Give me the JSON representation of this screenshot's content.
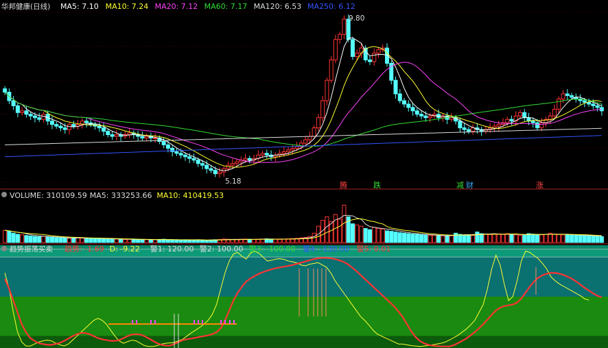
{
  "price_panel": {
    "title": "华邦健康(日线)",
    "ma": [
      {
        "label": "MA5: 7.10",
        "color": "#ffffff"
      },
      {
        "label": "MA10: 7.24",
        "color": "#ffff33"
      },
      {
        "label": "MA20: 7.12",
        "color": "#ff44ff"
      },
      {
        "label": "MA60: 7.17",
        "color": "#33dd33"
      },
      {
        "label": "MA120: 6.53",
        "color": "#dddddd"
      },
      {
        "label": "MA250: 6.12",
        "color": "#3355ff"
      }
    ],
    "high_label": "9.80",
    "low_label": "5.18",
    "event_tags": [
      {
        "text": "腾",
        "color": "#ff4444"
      },
      {
        "text": "跌",
        "color": "#33dd33"
      },
      {
        "text": "减",
        "color": "#33dd33"
      },
      {
        "text": "财",
        "color": "#33aaff"
      },
      {
        "text": "涨",
        "color": "#ff4444"
      }
    ]
  },
  "volume_panel": {
    "labels": [
      {
        "label": "VOLUME: 310109.59",
        "color": "#dddddd"
      },
      {
        "label": "MA5: 333253.66",
        "color": "#dddddd"
      },
      {
        "label": "MA10: 410419.53",
        "color": "#ffff33"
      }
    ]
  },
  "indicator_panel": {
    "title": "趋势振荡买卖",
    "labels": [
      {
        "label": "趋势: -1.69",
        "color": "#ff3333"
      },
      {
        "label": "D: -9.22",
        "color": "#ffff33"
      },
      {
        "label": "警1: 120.00",
        "color": "#dddddd"
      },
      {
        "label": "警2: 100.00",
        "color": "#dddddd"
      },
      {
        "label": "警3: -100.00",
        "color": "#33dd33"
      },
      {
        "label": "警4: -130.00",
        "color": "#3355ff"
      },
      {
        "label": "警5: 0.01",
        "color": "#ff3333"
      }
    ]
  },
  "chart_data": [
    {
      "type": "candlestick",
      "title": "华邦健康(日线)",
      "x": [
        1,
        2,
        3,
        4,
        5,
        6,
        7,
        8,
        9,
        10,
        11,
        12,
        13,
        14,
        15,
        16,
        17,
        18,
        19,
        20,
        21,
        22,
        23,
        24,
        25,
        26,
        27,
        28,
        29,
        30,
        31,
        32,
        33,
        34,
        35,
        36,
        37,
        38,
        39,
        40,
        41,
        42,
        43,
        44,
        45,
        46,
        47,
        48,
        49,
        50,
        51,
        52,
        53,
        54,
        55,
        56,
        57,
        58,
        59,
        60,
        61,
        62,
        63,
        64,
        65,
        66,
        67,
        68,
        69,
        70,
        71,
        72,
        73,
        74,
        75,
        76,
        77,
        78,
        79,
        80,
        81,
        82,
        83,
        84,
        85,
        86,
        87,
        88,
        89,
        90,
        91,
        92,
        93,
        94,
        95,
        96,
        97,
        98,
        99,
        100,
        101,
        102,
        103,
        104,
        105,
        106,
        107,
        108,
        109,
        110,
        111,
        112,
        113,
        114,
        115,
        116,
        117,
        118,
        119,
        120,
        121,
        122,
        123,
        124,
        125,
        126,
        127,
        128,
        129,
        130,
        131,
        132,
        133,
        134,
        135,
        136,
        137,
        138,
        139,
        140
      ],
      "close": [
        7.65,
        7.4,
        7.25,
        7.05,
        7.1,
        7.0,
        6.95,
        6.9,
        6.85,
        7.0,
        6.8,
        6.7,
        6.65,
        6.6,
        6.55,
        6.7,
        6.65,
        6.7,
        6.8,
        6.75,
        6.7,
        6.65,
        6.6,
        6.5,
        6.4,
        6.35,
        6.4,
        6.35,
        6.4,
        6.45,
        6.4,
        6.35,
        6.3,
        6.35,
        6.3,
        6.3,
        6.2,
        6.1,
        6.0,
        5.9,
        5.85,
        5.8,
        5.75,
        5.7,
        5.65,
        5.55,
        5.5,
        5.4,
        5.35,
        5.25,
        5.3,
        5.4,
        5.5,
        5.55,
        5.6,
        5.65,
        5.7,
        5.65,
        5.7,
        5.8,
        5.85,
        5.8,
        5.75,
        5.8,
        5.85,
        5.9,
        5.95,
        6.0,
        6.05,
        6.15,
        6.25,
        6.35,
        6.6,
        6.9,
        7.4,
        8.0,
        8.6,
        9.2,
        9.35,
        9.8,
        9.2,
        8.7,
        8.8,
        8.95,
        8.6,
        8.55,
        8.8,
        8.9,
        8.95,
        8.5,
        8.0,
        7.6,
        7.4,
        7.3,
        7.2,
        7.1,
        7.0,
        6.95,
        6.9,
        6.95,
        7.0,
        6.9,
        6.95,
        6.85,
        6.9,
        6.8,
        6.6,
        6.55,
        6.5,
        6.6,
        6.55,
        6.5,
        6.55,
        6.6,
        6.65,
        6.7,
        6.75,
        6.85,
        6.8,
        6.95,
        7.05,
        6.9,
        6.8,
        6.75,
        6.6,
        6.75,
        6.85,
        6.95,
        7.15,
        7.45,
        7.6,
        7.55,
        7.5,
        7.45,
        7.4,
        7.35,
        7.3,
        7.25,
        7.2,
        7.1
      ]
    },
    {
      "type": "bar",
      "title": "VOLUME",
      "values": [
        52,
        48,
        40,
        35,
        33,
        30,
        28,
        26,
        25,
        27,
        24,
        22,
        21,
        20,
        19,
        18,
        20,
        21,
        19,
        18,
        17,
        18,
        17,
        16,
        15,
        14,
        15,
        14,
        13,
        14,
        13,
        12,
        13,
        12,
        11,
        12,
        13,
        14,
        12,
        11,
        10,
        11,
        12,
        10,
        11,
        12,
        10,
        9,
        11,
        12,
        13,
        15,
        14,
        13,
        12,
        14,
        15,
        14,
        13,
        14,
        15,
        16,
        15,
        14,
        13,
        15,
        16,
        17,
        18,
        20,
        22,
        26,
        40,
        70,
        95,
        110,
        90,
        120,
        100,
        160,
        110,
        80,
        75,
        70,
        60,
        55,
        65,
        60,
        58,
        50,
        48,
        45,
        42,
        40,
        38,
        36,
        35,
        33,
        32,
        30,
        31,
        30,
        28,
        30,
        29,
        40,
        35,
        33,
        32,
        30,
        45,
        38,
        36,
        34,
        35,
        37,
        34,
        38,
        36,
        33,
        30,
        32,
        38,
        36,
        34,
        33,
        35,
        40,
        36,
        34,
        33,
        34,
        32,
        31,
        30,
        29,
        28,
        27,
        26,
        25
      ],
      "series": [
        {
          "name": "MA5",
          "values": []
        },
        {
          "name": "MA10",
          "values": []
        }
      ]
    },
    {
      "type": "line",
      "title": "趋势振荡买卖",
      "ylim": [
        -130,
        130
      ],
      "series": [
        {
          "name": "趋势",
          "color": "#ff3333",
          "values": [
            45,
            20,
            -10,
            -40,
            -70,
            -90,
            -105,
            -112,
            -118,
            -120,
            -122,
            -122,
            -120,
            -117,
            -112,
            -106,
            -100,
            -95,
            -92,
            -92,
            -95,
            -100,
            -105,
            -108,
            -110,
            -112,
            -112,
            -110,
            -105,
            -100,
            -96,
            -95,
            -96,
            -100,
            -106,
            -112,
            -118,
            -122,
            -124,
            -124,
            -120,
            -115,
            -110,
            -108,
            -106,
            -104,
            -102,
            -100,
            -98,
            -95,
            -90,
            -80,
            -60,
            -35,
            -10,
            10,
            25,
            38,
            46,
            52,
            58,
            62,
            66,
            69,
            72,
            74,
            76,
            78,
            80,
            83,
            86,
            89,
            92,
            95,
            97,
            98,
            98,
            97,
            95,
            92,
            88,
            82,
            74,
            65,
            55,
            45,
            35,
            25,
            15,
            5,
            -5,
            -15,
            -25,
            -38,
            -52,
            -70,
            -88,
            -102,
            -112,
            -118,
            -122,
            -124,
            -125,
            -126,
            -126,
            -126,
            -123,
            -118,
            -112,
            -106,
            -98,
            -90,
            -80,
            -70,
            -58,
            -46,
            -35,
            -28,
            -24,
            -22,
            -20,
            -15,
            -5,
            10,
            25,
            38,
            48,
            54,
            58,
            60,
            60,
            58,
            55,
            50,
            45,
            38,
            30,
            22,
            15,
            8,
            2,
            -2
          ]
        },
        {
          "name": "D",
          "color": "#ffff33",
          "values": [
            60,
            20,
            -40,
            -90,
            -115,
            -125,
            -125,
            -120,
            -115,
            -112,
            -110,
            -112,
            -118,
            -122,
            -125,
            -120,
            -110,
            -100,
            -90,
            -80,
            -70,
            -60,
            -55,
            -60,
            -70,
            -85,
            -100,
            -112,
            -118,
            -114,
            -110,
            -112,
            -118,
            -124,
            -126,
            -126,
            -124,
            -120,
            -118,
            -117,
            -116,
            -112,
            -108,
            -100,
            -92,
            -85,
            -78,
            -70,
            -60,
            -45,
            -20,
            20,
            60,
            90,
            108,
            112,
            102,
            95,
            110,
            115,
            110,
            100,
            90,
            92,
            95,
            96,
            94,
            90,
            88,
            85,
            80,
            78,
            82,
            84,
            86,
            80,
            74,
            60,
            40,
            25,
            10,
            -5,
            -20,
            -35,
            -50,
            -60,
            -72,
            -85,
            -95,
            -100,
            -105,
            -110,
            -115,
            -120,
            -120,
            -122,
            -124,
            -125,
            -126,
            -125,
            -124,
            -122,
            -120,
            -118,
            -115,
            -110,
            -104,
            -98,
            -90,
            -82,
            -72,
            -60,
            -40,
            -20,
            20,
            70,
            105,
            80,
            30,
            -10,
            0,
            40,
            90,
            115,
            112,
            104,
            96,
            84,
            70,
            50,
            40,
            32,
            26,
            20,
            14,
            8,
            2,
            -6,
            -9
          ]
        },
        {
          "name": "警1",
          "color": "#dddddd",
          "values": [
            120
          ]
        },
        {
          "name": "警2",
          "color": "#dddddd",
          "values": [
            100
          ]
        },
        {
          "name": "警3",
          "color": "#33dd33",
          "values": [
            -100
          ]
        },
        {
          "name": "警4",
          "color": "#3355ff",
          "values": [
            -130
          ]
        },
        {
          "name": "警5",
          "color": "#ff3333",
          "values": [
            0.01
          ]
        }
      ]
    }
  ]
}
